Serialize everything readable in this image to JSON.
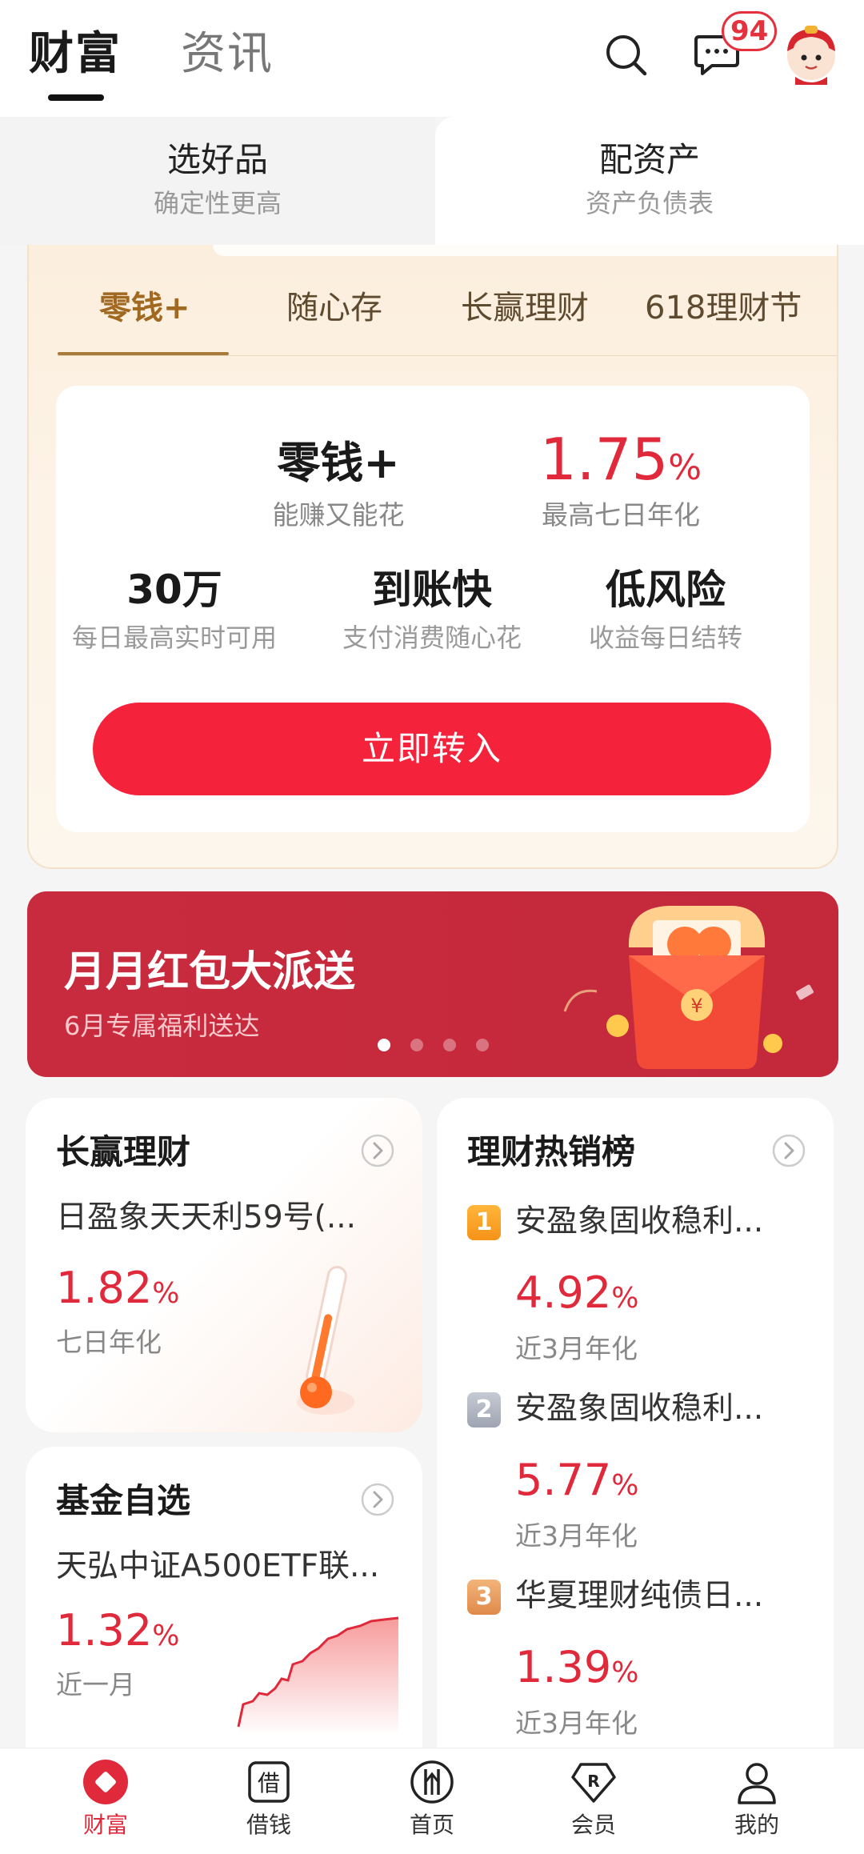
{
  "header": {
    "tabs": [
      {
        "label": "财富",
        "active": true
      },
      {
        "label": "资讯",
        "active": false
      }
    ],
    "message_badge": "94",
    "icons": [
      "search-icon",
      "message-icon",
      "avatar"
    ]
  },
  "segments": [
    {
      "title": "选好品",
      "subtitle": "确定性更高"
    },
    {
      "title": "配资产",
      "subtitle": "资产负债表"
    }
  ],
  "product_tabs": [
    {
      "label": "零钱+",
      "active": true
    },
    {
      "label": "随心存",
      "active": false
    },
    {
      "label": "长赢理财",
      "active": false
    },
    {
      "label": "618理财节",
      "active": false
    }
  ],
  "product_card": {
    "name": "零钱+",
    "name_sub": "能赚又能花",
    "rate": "1.75",
    "rate_unit": "%",
    "rate_sub": "最高七日年化",
    "features": [
      {
        "title": "30万",
        "subtitle": "每日最高实时可用"
      },
      {
        "title": "到账快",
        "subtitle": "支付消费随心花"
      },
      {
        "title": "低风险",
        "subtitle": "收益每日结转"
      }
    ],
    "cta": "立即转入"
  },
  "banner": {
    "title": "月月红包大派送",
    "subtitle": "6月专属福利送达",
    "page_count": 4,
    "active_page": 1
  },
  "cards": {
    "changying": {
      "title": "长赢理财",
      "product": "日盈象天天利59号(...",
      "rate": "1.82",
      "rate_unit": "%",
      "rate_sub": "七日年化"
    },
    "fund": {
      "title": "基金自选",
      "product": "天弘中证A500ETF联...",
      "rate": "1.32",
      "rate_unit": "%",
      "rate_sub": "近一月"
    },
    "hot": {
      "title": "理财热销榜",
      "items": [
        {
          "rank": "1",
          "name": "安盈象固收稳利...",
          "rate": "4.92",
          "rate_unit": "%",
          "sub": "近3月年化"
        },
        {
          "rank": "2",
          "name": "安盈象固收稳利...",
          "rate": "5.77",
          "rate_unit": "%",
          "sub": "近3月年化"
        },
        {
          "rank": "3",
          "name": "华夏理财纯债日...",
          "rate": "1.39",
          "rate_unit": "%",
          "sub": "近3月年化"
        }
      ]
    }
  },
  "bottom_nav": [
    {
      "label": "财富",
      "active": true
    },
    {
      "label": "借钱",
      "active": false
    },
    {
      "label": "首页",
      "active": false
    },
    {
      "label": "会员",
      "active": false
    },
    {
      "label": "我的",
      "active": false
    }
  ],
  "colors": {
    "accent_red": "#e0293b",
    "button_red": "#f5223b",
    "gold": "#a06820",
    "banner_red": "#c92b3e"
  }
}
